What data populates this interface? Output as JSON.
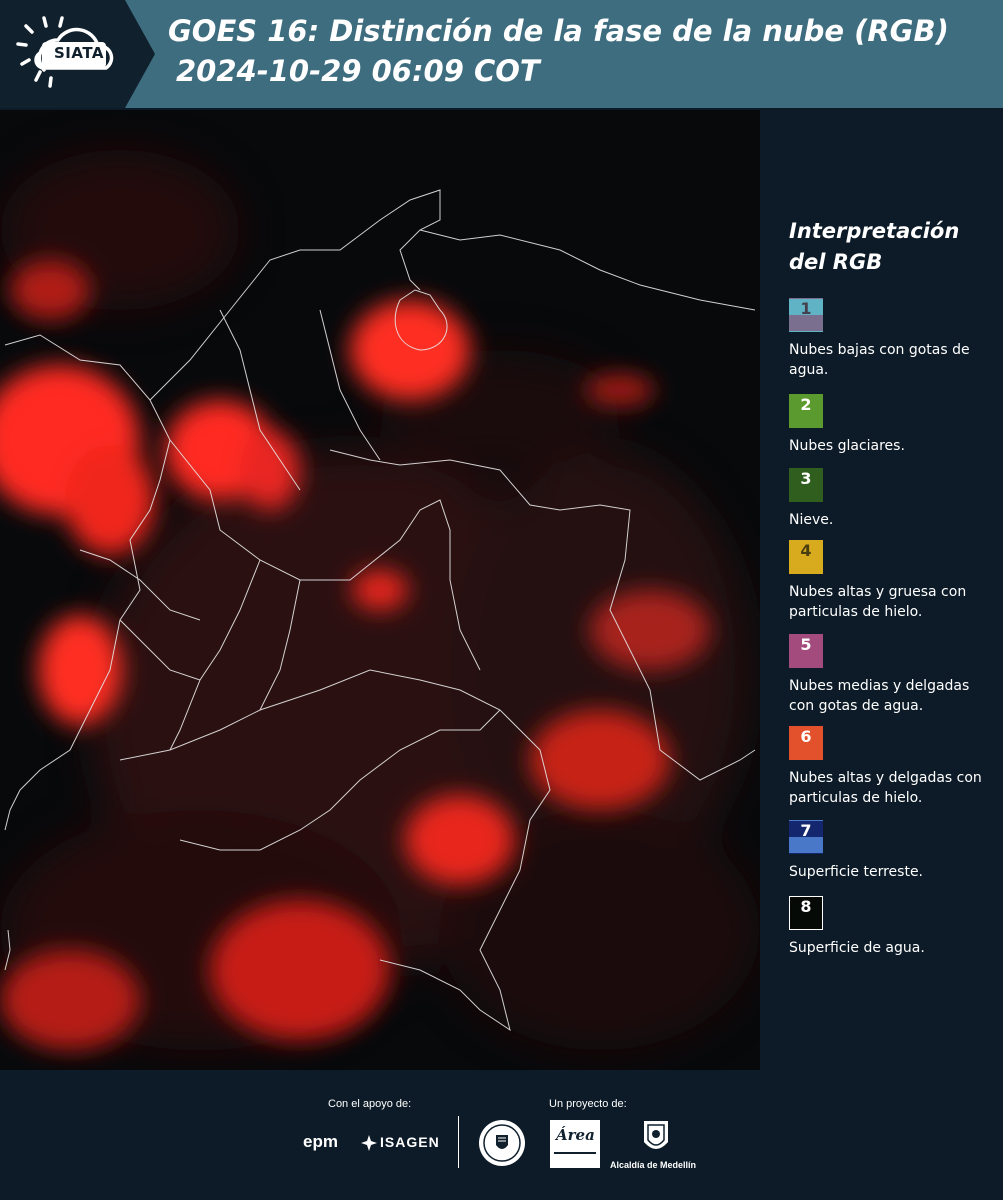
{
  "header": {
    "logo_text": "SIATA",
    "title": "GOES 16: Distinción de la fase de la nube (RGB)",
    "subtitle": "2024-10-29 06:09 COT"
  },
  "legend": {
    "title_line1": "Interpretación",
    "title_line2": "del RGB",
    "items": [
      {
        "number": "1",
        "label": "Nubes bajas con gotas de agua.",
        "color_top": "#5fb3c4",
        "color_bottom": "#7a6f8e"
      },
      {
        "number": "2",
        "label": "Nubes glaciares.",
        "color_top": "#5b9a2e",
        "color_bottom": "#5b9a2e"
      },
      {
        "number": "3",
        "label": "Nieve.",
        "color_top": "#2f5e1e",
        "color_bottom": "#2f5e1e"
      },
      {
        "number": "4",
        "label": "Nubes altas y gruesa con particulas de hielo.",
        "color_top": "#d8ab1f",
        "color_bottom": "#d8ab1f"
      },
      {
        "number": "5",
        "label": "Nubes medias y delgadas con gotas de agua.",
        "color_top": "#a44b7d",
        "color_bottom": "#a44b7d"
      },
      {
        "number": "6",
        "label": "Nubes altas y delgadas con particulas de hielo.",
        "color_top": "#e2502c",
        "color_bottom": "#e2502c"
      },
      {
        "number": "7",
        "label": "Superficie terreste.",
        "color_top": "#13266e",
        "color_bottom": "#4a78c9"
      },
      {
        "number": "8",
        "label": "Superficie de agua.",
        "color_top": "#050a07",
        "color_bottom": "#050a07"
      }
    ]
  },
  "footer": {
    "support_label": "Con el apoyo de:",
    "project_label": "Un proyecto de:",
    "sponsor_epm": "epm",
    "sponsor_isagen": "ISAGEN",
    "partner_area": "Área",
    "partner_alcaldia": "Alcaldía de Medellín"
  }
}
